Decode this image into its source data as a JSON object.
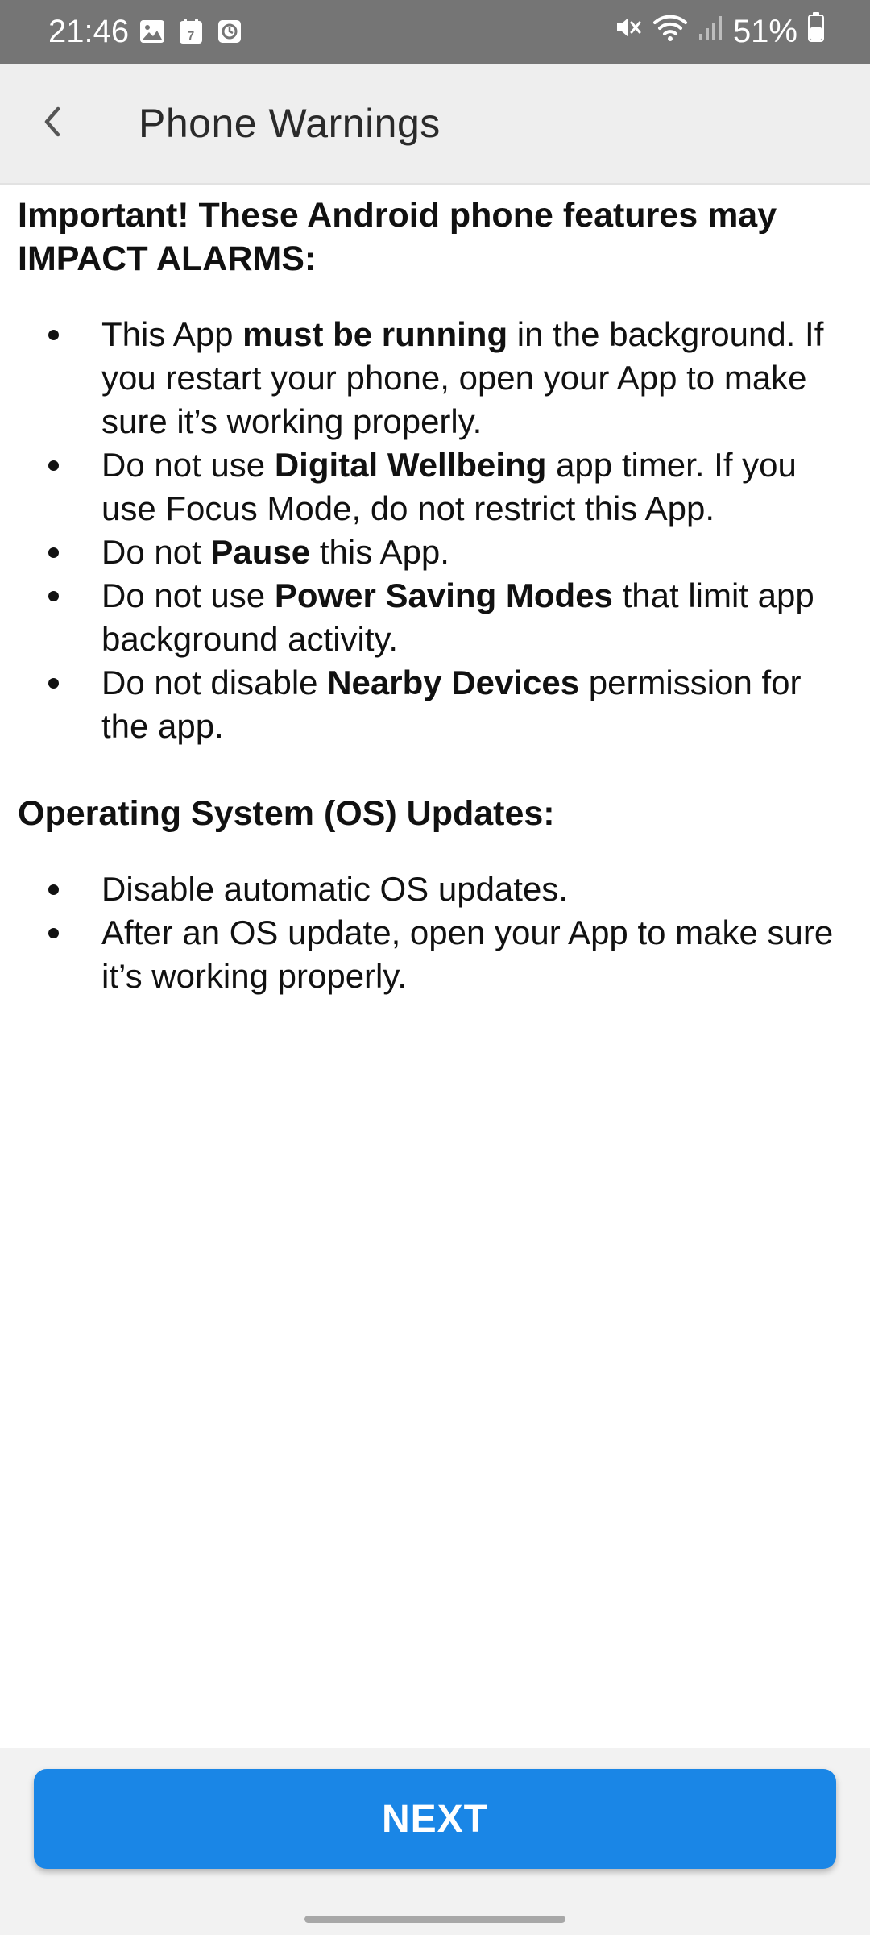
{
  "status_bar": {
    "time": "21:46",
    "battery": "51%",
    "left_icons": [
      "gallery-icon",
      "calendar-icon",
      "clock-notification-icon"
    ],
    "right_icons": [
      "mute-icon",
      "wifi-icon",
      "signal-icon",
      "battery-icon"
    ],
    "calendar_day": "7"
  },
  "header": {
    "back_icon": "chevron-left-icon",
    "title": "Phone Warnings"
  },
  "sections": [
    {
      "heading": "Important! These Android phone features may IMPACT ALARMS:",
      "items": [
        {
          "pre": "This App ",
          "bold": "must be running",
          "post": " in the background. If you restart your phone, open your App to make sure it’s working properly."
        },
        {
          "pre": "Do not use ",
          "bold": "Digital Wellbeing",
          "post": " app timer. If you use Focus Mode, do not restrict this App."
        },
        {
          "pre": "Do not ",
          "bold": "Pause",
          "post": " this App."
        },
        {
          "pre": "Do not use ",
          "bold": "Power Saving Modes",
          "post": " that limit app background activity."
        },
        {
          "pre": "Do not disable ",
          "bold": "Nearby Devices",
          "post": " permission for the app."
        }
      ]
    },
    {
      "heading": "Operating System (OS) Updates:",
      "items": [
        {
          "text": "Disable automatic OS updates."
        },
        {
          "text": "After an OS update, open your App to make sure it’s working properly."
        }
      ]
    }
  ],
  "footer": {
    "next_label": "NEXT",
    "accent_color": "#1a86e6"
  }
}
